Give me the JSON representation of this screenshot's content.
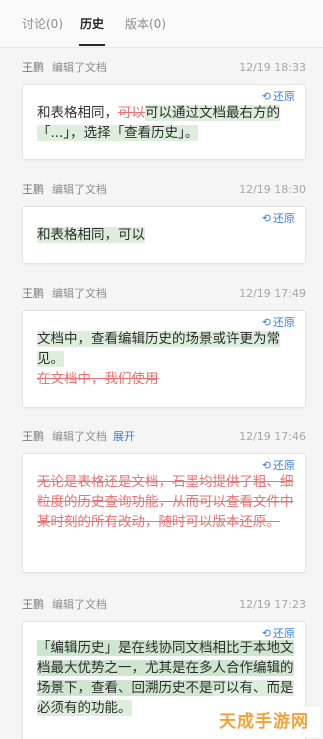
{
  "tabs": [
    {
      "label": "讨论(0)"
    },
    {
      "label": "历史"
    },
    {
      "label": "版本(0)"
    }
  ],
  "restore_label": "还原",
  "entries": [
    {
      "user": "王鹏",
      "action": "编辑了文档",
      "time": "12/19 18:33",
      "segments": [
        {
          "text": "和表格相同，",
          "type": "normal"
        },
        {
          "text": "可以",
          "type": "deleted"
        },
        {
          "text": "可以通过文档最右方的「...」，选择「查看历史」。",
          "type": "added"
        }
      ]
    },
    {
      "user": "王鹏",
      "action": "编辑了文档",
      "time": "12/19 18:30",
      "segments": [
        {
          "text": "和表格相同，可以",
          "type": "added"
        }
      ]
    },
    {
      "user": "王鹏",
      "action": "编辑了文档",
      "time": "12/19 17:49",
      "segments": [
        {
          "text": "文档中，查看编辑历史的场景或许更为常见。",
          "type": "added"
        },
        {
          "text": "在文档中，我们使用",
          "type": "deleted"
        }
      ]
    },
    {
      "user": "王鹏",
      "action": "编辑了文档",
      "expand": "展开",
      "time": "12/19 17:46",
      "segments": [
        {
          "text": "无论是表格还是文档，石墨均提供了粗、细粒度的历史查询功能，从而可以查看文件中某时刻的所有改动，随时可以版本还原。",
          "type": "deleted"
        }
      ]
    },
    {
      "user": "王鹏",
      "action": "编辑了文档",
      "time": "12/19 17:23",
      "segments": [
        {
          "text": "「编辑历史」是在线协同文档相比于本地文档最大优势之一，尤其是在多人合作编辑的场景下，查看、回溯历史不是",
          "type": "added-strong"
        },
        {
          "text": "可以有、而是必须有的功能。",
          "type": "added"
        }
      ]
    }
  ],
  "watermark": "天成手游网"
}
